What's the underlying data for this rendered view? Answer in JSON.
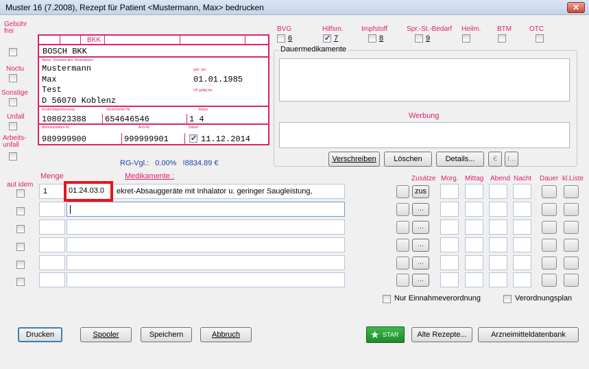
{
  "window": {
    "title": "Muster 16 (7.2008), Rezept für Patient <Mustermann, Max> bedrucken",
    "close_label": "✕"
  },
  "left_flags": {
    "gebuehr_frei": "Gebühr frei",
    "noctu": "Noctu",
    "sonstige": "Sonstige",
    "unfall": "Unfall",
    "arbeitsunfall": "Arbeits-unfall",
    "aut_idem": "aut idem"
  },
  "form": {
    "kasse_label": "BKK",
    "kasse_name": "BOSCH BKK",
    "name_header": "Name, Vorname des Versicherten",
    "last_name": "Mustermann",
    "first_name": "Max",
    "birth_label": "geb. am",
    "birth_date": "01.01.1985",
    "street": "Test",
    "city": "D 56070 Koblenz",
    "valid_label": "VK gültig bis",
    "kt_label": "Kostenträgerkennung",
    "kt_value": "108023388",
    "vn_label": "Versicherten-Nr.",
    "vn_value": "654646546",
    "status_label": "Status",
    "status_value": "1 4",
    "bs_label": "Betriebsstätten-Nr.",
    "bs_value": "989999900",
    "arzt_label": "Arzt-Nr.",
    "arzt_value": "999999901",
    "datum_label": "Datum",
    "datum_value": "11.12.2014"
  },
  "rg_vgl": {
    "label": "RG-Vgl.:",
    "percent": "0.00%",
    "amount": "!8834.89 €"
  },
  "right_flags": [
    {
      "label": "BVG",
      "num": "6",
      "checked": false
    },
    {
      "label": "Hilfsm.",
      "num": "7",
      "checked": true
    },
    {
      "label": "Impfstoff",
      "num": "8",
      "checked": false
    },
    {
      "label": "Spr.-St.-Bedarf",
      "num": "9",
      "checked": false
    },
    {
      "label": "Heilm.",
      "num": "",
      "checked": false
    },
    {
      "label": "BTM",
      "num": "",
      "checked": false
    },
    {
      "label": "OTC",
      "num": "",
      "checked": false
    }
  ],
  "dauermedikamente_label": "Dauermedikamente",
  "werbung_label": "Werbung",
  "buttons": {
    "verschreiben": "Verschreiben",
    "loeschen": "Löschen",
    "details": "Details...",
    "euro": "€",
    "i": "I...",
    "drucken": "Drucken",
    "spooler": "Spooler",
    "speichern": "Speichern",
    "abbruch": "Abbruch",
    "star": "STAR",
    "alte_rezepte": "Alte Rezepte...",
    "arzneimitteldatenbank": "Arzneimitteldatenbank",
    "zus": "zus",
    "more": "..."
  },
  "grid_headers": {
    "menge": "Menge",
    "medikamente": "Medikamente :",
    "zusaetze": "Zusätze",
    "morg": "Morg.",
    "mittag": "Mittag",
    "abend": "Abend",
    "nacht": "Nacht",
    "dauer": "Dauer",
    "klliste": "kl.Liste"
  },
  "rows": [
    {
      "menge": "1",
      "code": "01.24.03.0",
      "text": "ekret-Absauggeräte mit Inhalator u. geringer Saugleistung,"
    },
    {
      "menge": "",
      "code": "",
      "text": ""
    },
    {
      "menge": "",
      "code": "",
      "text": ""
    },
    {
      "menge": "",
      "code": "",
      "text": ""
    },
    {
      "menge": "",
      "code": "",
      "text": ""
    },
    {
      "menge": "",
      "code": "",
      "text": ""
    }
  ],
  "options": {
    "nur_einnahme": "Nur Einnahmeverordnung",
    "verordnungsplan": "Verordnungsplan"
  },
  "colors": {
    "accent": "#e0206a",
    "highlight": "#e8141c",
    "link_blue": "#1f3fb0"
  }
}
